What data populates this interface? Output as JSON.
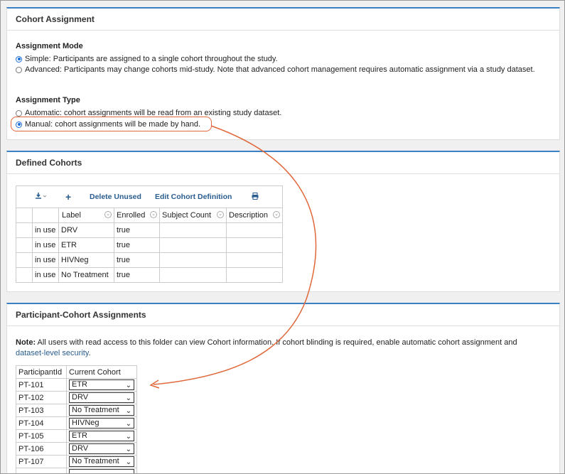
{
  "cohort_assignment": {
    "title": "Cohort Assignment",
    "mode_title": "Assignment Mode",
    "mode_options": [
      {
        "label": "Simple: Participants are assigned to a single cohort throughout the study.",
        "checked": true
      },
      {
        "label": "Advanced: Participants may change cohorts mid-study. Note that advanced cohort management requires automatic assignment via a study dataset.",
        "checked": false
      }
    ],
    "type_title": "Assignment Type",
    "type_options": [
      {
        "label": "Automatic: cohort assignments will be read from an existing study dataset.",
        "checked": false
      },
      {
        "label": "Manual: cohort assignments will be made by hand.",
        "checked": true
      }
    ]
  },
  "defined_cohorts": {
    "title": "Defined Cohorts",
    "toolbar": {
      "export_icon": "download-icon",
      "add_icon": "plus-icon",
      "delete_unused": "Delete Unused",
      "edit_definition": "Edit Cohort Definition",
      "print_icon": "print-icon"
    },
    "columns": [
      "Label",
      "Enrolled",
      "Subject Count",
      "Description"
    ],
    "rows": [
      {
        "status": "in use",
        "label": "DRV",
        "enrolled": "true",
        "subject_count": "",
        "description": ""
      },
      {
        "status": "in use",
        "label": "ETR",
        "enrolled": "true",
        "subject_count": "",
        "description": ""
      },
      {
        "status": "in use",
        "label": "HIVNeg",
        "enrolled": "true",
        "subject_count": "",
        "description": ""
      },
      {
        "status": "in use",
        "label": "No Treatment",
        "enrolled": "true",
        "subject_count": "",
        "description": ""
      }
    ]
  },
  "participant_assignments": {
    "title": "Participant-Cohort Assignments",
    "note_label": "Note:",
    "note_text": " All users with read access to this folder can view Cohort information. If cohort blinding is required, enable automatic cohort assignment and",
    "note_link": "dataset-level security",
    "note_end": ".",
    "columns": [
      "ParticipantId",
      "Current Cohort"
    ],
    "rows": [
      {
        "id": "PT-101",
        "cohort": "ETR"
      },
      {
        "id": "PT-102",
        "cohort": "DRV"
      },
      {
        "id": "PT-103",
        "cohort": "No Treatment"
      },
      {
        "id": "PT-104",
        "cohort": "HIVNeg"
      },
      {
        "id": "PT-105",
        "cohort": "ETR"
      },
      {
        "id": "PT-106",
        "cohort": "DRV"
      },
      {
        "id": "PT-107",
        "cohort": "No Treatment"
      }
    ]
  },
  "accent_color": "#3b7fc4",
  "annotation_color": "#e0683a"
}
